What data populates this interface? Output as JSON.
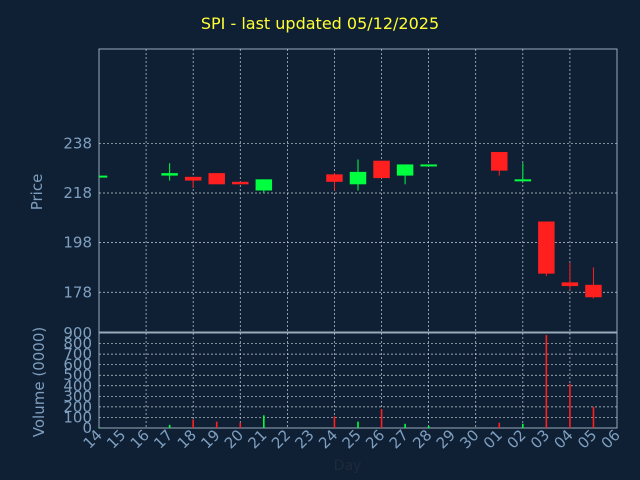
{
  "chart_data": [
    {
      "type": "candlestick",
      "title": "SPI - last updated 05/12/2025",
      "xlabel": "Day",
      "ylabel": "Price",
      "ylim": [
        162,
        276
      ],
      "yticks": [
        178,
        198,
        218,
        238
      ],
      "grid": true,
      "up_color": "#00ff3f",
      "down_color": "#ff1f1f",
      "x": [
        "14",
        "15",
        "16",
        "17",
        "18",
        "19",
        "20",
        "21",
        "22",
        "23",
        "24",
        "25",
        "26",
        "27",
        "28",
        "29",
        "30",
        "01",
        "02",
        "03",
        "04",
        "05",
        "06"
      ],
      "candles": [
        {
          "day": "14",
          "open": 225,
          "close": 225,
          "high": 225,
          "low": 225
        },
        {
          "day": "17",
          "open": 225,
          "close": 226,
          "high": 230,
          "low": 223
        },
        {
          "day": "18",
          "open": 224.5,
          "close": 223,
          "high": 224.5,
          "low": 220
        },
        {
          "day": "19",
          "open": 226,
          "close": 221.5,
          "high": 226,
          "low": 221.5
        },
        {
          "day": "20",
          "open": 222.5,
          "close": 221.5,
          "high": 222.5,
          "low": 221.5
        },
        {
          "day": "21",
          "open": 219,
          "close": 223.5,
          "high": 223.5,
          "low": 218
        },
        {
          "day": "24",
          "open": 225.5,
          "close": 222.5,
          "high": 226,
          "low": 219
        },
        {
          "day": "25",
          "open": 221.5,
          "close": 226.5,
          "high": 231.5,
          "low": 219
        },
        {
          "day": "26",
          "open": 231,
          "close": 224,
          "high": 231,
          "low": 224
        },
        {
          "day": "27",
          "open": 225,
          "close": 229.5,
          "high": 229.5,
          "low": 221.5
        },
        {
          "day": "28",
          "open": 229,
          "close": 229.5,
          "high": 229.5,
          "low": 229
        },
        {
          "day": "01",
          "open": 234.5,
          "close": 227,
          "high": 234.5,
          "low": 225
        },
        {
          "day": "02",
          "open": 223.5,
          "close": 223.5,
          "high": 230,
          "low": 223.5
        },
        {
          "day": "03",
          "open": 206.5,
          "close": 185.5,
          "high": 206.5,
          "low": 184.5
        },
        {
          "day": "04",
          "open": 182,
          "close": 180.5,
          "high": 190,
          "low": 179
        },
        {
          "day": "05",
          "open": 181,
          "close": 176,
          "high": 188,
          "low": 175.5
        }
      ]
    },
    {
      "type": "bar",
      "ylabel": "Volume (0000)",
      "ylim": [
        0,
        900
      ],
      "yticks": [
        0,
        100,
        200,
        300,
        400,
        500,
        600,
        700,
        800,
        900
      ],
      "categories": [
        "14",
        "15",
        "16",
        "17",
        "18",
        "19",
        "20",
        "21",
        "22",
        "23",
        "24",
        "25",
        "26",
        "27",
        "28",
        "29",
        "30",
        "01",
        "02",
        "03",
        "04",
        "05",
        "06"
      ],
      "values": [
        5,
        0,
        0,
        30,
        80,
        60,
        50,
        120,
        0,
        0,
        110,
        60,
        180,
        40,
        20,
        0,
        0,
        50,
        40,
        880,
        420,
        200,
        0
      ],
      "colors": [
        "#00ff3f",
        "#000000",
        "#000000",
        "#00ff3f",
        "#ff1f1f",
        "#ff1f1f",
        "#ff1f1f",
        "#00ff3f",
        "#000000",
        "#000000",
        "#ff1f1f",
        "#00ff3f",
        "#ff1f1f",
        "#00ff3f",
        "#00ff3f",
        "#000000",
        "#000000",
        "#ff1f1f",
        "#00ff3f",
        "#ff1f1f",
        "#ff1f1f",
        "#ff1f1f",
        "#000000"
      ]
    }
  ]
}
